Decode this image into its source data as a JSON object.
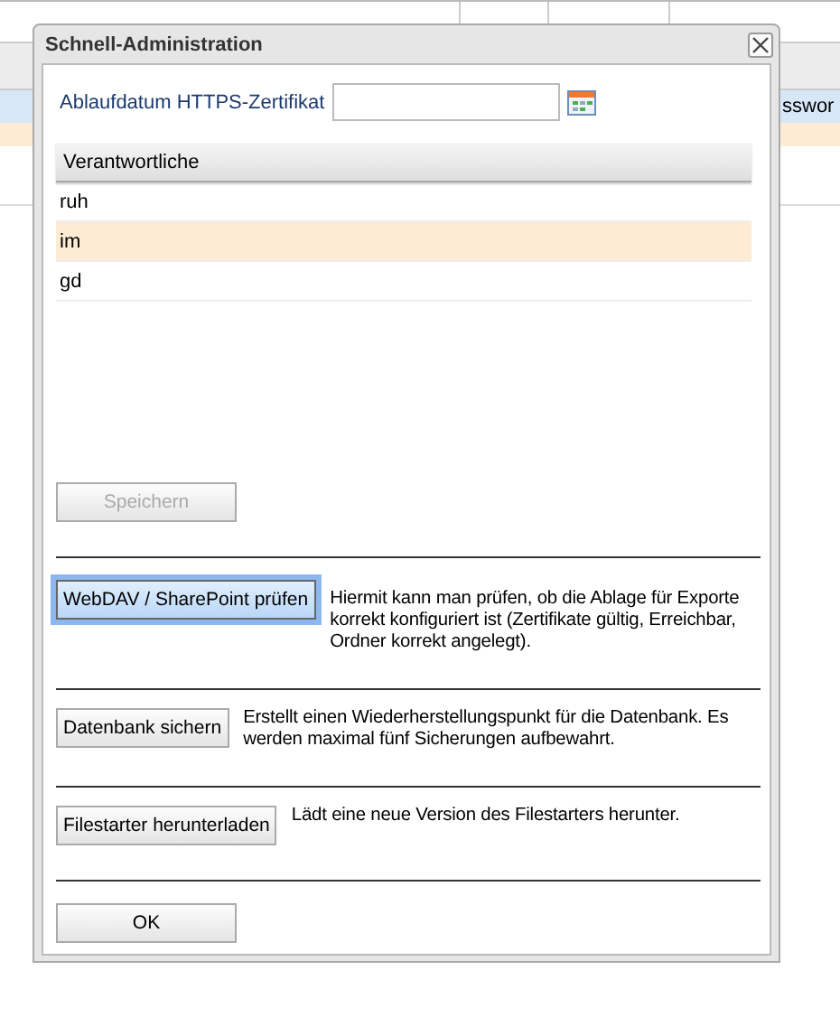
{
  "background": {
    "visible_cell": "sswor"
  },
  "dialog": {
    "title": "Schnell-Administration",
    "certificate_field": {
      "label": "Ablaufdatum HTTPS-Zertifikat"
    },
    "responsible_list": {
      "header": "Verantwortliche",
      "rows": [
        {
          "name": "ruh",
          "selected": false
        },
        {
          "name": "im",
          "selected": true
        },
        {
          "name": "gd",
          "selected": false
        }
      ]
    },
    "save_button": {
      "label": "Speichern",
      "disabled": true
    },
    "actions": [
      {
        "button": "WebDAV / SharePoint prüfen",
        "focused": true,
        "description": "Hiermit kann man prüfen, ob die Ablage für Exporte korrekt konfiguriert ist (Zertifikate gültig, Erreichbar, Ordner korrekt angelegt)."
      },
      {
        "button": "Datenbank sichern",
        "focused": false,
        "description": "Erstellt einen Wiederherstellungspunkt für die Datenbank. Es werden maximal fünf Sicherungen aufbewahrt."
      },
      {
        "button": "Filestarter herunterladen",
        "focused": false,
        "description": "Lädt eine neue Version des Filestarters herunter."
      }
    ],
    "ok_button": "OK"
  }
}
